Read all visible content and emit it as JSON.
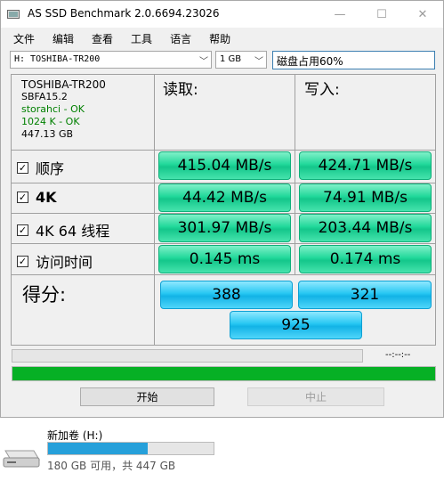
{
  "window": {
    "title": "AS SSD Benchmark 2.0.6694.23026"
  },
  "menu": [
    "文件",
    "编辑",
    "查看",
    "工具",
    "语言",
    "帮助"
  ],
  "toolbar": {
    "drive": "H: TOSHIBA-TR200",
    "size": "1 GB",
    "usage": "磁盘占用60%"
  },
  "info": {
    "model": "TOSHIBA-TR200",
    "firmware": "SBFA15.2",
    "driver": "storahci - OK",
    "alignment": "1024 K - OK",
    "capacity": "447.13 GB"
  },
  "headers": {
    "read": "读取:",
    "write": "写入:"
  },
  "rows": [
    {
      "label": "顺序",
      "read": "415.04 MB/s",
      "write": "424.71 MB/s"
    },
    {
      "label": "4K",
      "read": "44.42 MB/s",
      "write": "74.91 MB/s"
    },
    {
      "label": "4K 64 线程",
      "read": "301.97 MB/s",
      "write": "203.44 MB/s"
    },
    {
      "label": "访问时间",
      "read": "0.145 ms",
      "write": "0.174 ms"
    }
  ],
  "score": {
    "label": "得分:",
    "read": "388",
    "write": "321",
    "total": "925"
  },
  "progress": {
    "time": "--:--:--",
    "value": 1.0
  },
  "buttons": {
    "start": "开始",
    "abort": "中止"
  },
  "drive_tile": {
    "name": "新加卷 (H:)",
    "space": "180 GB 可用，共 447 GB",
    "used_fraction": 0.6
  },
  "colors": {
    "result": "#21d89a",
    "score": "#26c7f2",
    "progress": "#06b025",
    "drive_bar": "#26a0da"
  }
}
